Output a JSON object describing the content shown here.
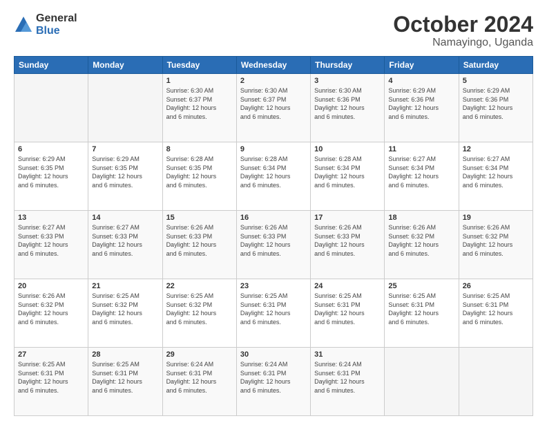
{
  "logo": {
    "general": "General",
    "blue": "Blue"
  },
  "header": {
    "month": "October 2024",
    "location": "Namayingo, Uganda"
  },
  "weekdays": [
    "Sunday",
    "Monday",
    "Tuesday",
    "Wednesday",
    "Thursday",
    "Friday",
    "Saturday"
  ],
  "weeks": [
    [
      {
        "day": "",
        "info": ""
      },
      {
        "day": "",
        "info": ""
      },
      {
        "day": "1",
        "info": "Sunrise: 6:30 AM\nSunset: 6:37 PM\nDaylight: 12 hours\nand 6 minutes."
      },
      {
        "day": "2",
        "info": "Sunrise: 6:30 AM\nSunset: 6:37 PM\nDaylight: 12 hours\nand 6 minutes."
      },
      {
        "day": "3",
        "info": "Sunrise: 6:30 AM\nSunset: 6:36 PM\nDaylight: 12 hours\nand 6 minutes."
      },
      {
        "day": "4",
        "info": "Sunrise: 6:29 AM\nSunset: 6:36 PM\nDaylight: 12 hours\nand 6 minutes."
      },
      {
        "day": "5",
        "info": "Sunrise: 6:29 AM\nSunset: 6:36 PM\nDaylight: 12 hours\nand 6 minutes."
      }
    ],
    [
      {
        "day": "6",
        "info": "Sunrise: 6:29 AM\nSunset: 6:35 PM\nDaylight: 12 hours\nand 6 minutes."
      },
      {
        "day": "7",
        "info": "Sunrise: 6:29 AM\nSunset: 6:35 PM\nDaylight: 12 hours\nand 6 minutes."
      },
      {
        "day": "8",
        "info": "Sunrise: 6:28 AM\nSunset: 6:35 PM\nDaylight: 12 hours\nand 6 minutes."
      },
      {
        "day": "9",
        "info": "Sunrise: 6:28 AM\nSunset: 6:34 PM\nDaylight: 12 hours\nand 6 minutes."
      },
      {
        "day": "10",
        "info": "Sunrise: 6:28 AM\nSunset: 6:34 PM\nDaylight: 12 hours\nand 6 minutes."
      },
      {
        "day": "11",
        "info": "Sunrise: 6:27 AM\nSunset: 6:34 PM\nDaylight: 12 hours\nand 6 minutes."
      },
      {
        "day": "12",
        "info": "Sunrise: 6:27 AM\nSunset: 6:34 PM\nDaylight: 12 hours\nand 6 minutes."
      }
    ],
    [
      {
        "day": "13",
        "info": "Sunrise: 6:27 AM\nSunset: 6:33 PM\nDaylight: 12 hours\nand 6 minutes."
      },
      {
        "day": "14",
        "info": "Sunrise: 6:27 AM\nSunset: 6:33 PM\nDaylight: 12 hours\nand 6 minutes."
      },
      {
        "day": "15",
        "info": "Sunrise: 6:26 AM\nSunset: 6:33 PM\nDaylight: 12 hours\nand 6 minutes."
      },
      {
        "day": "16",
        "info": "Sunrise: 6:26 AM\nSunset: 6:33 PM\nDaylight: 12 hours\nand 6 minutes."
      },
      {
        "day": "17",
        "info": "Sunrise: 6:26 AM\nSunset: 6:33 PM\nDaylight: 12 hours\nand 6 minutes."
      },
      {
        "day": "18",
        "info": "Sunrise: 6:26 AM\nSunset: 6:32 PM\nDaylight: 12 hours\nand 6 minutes."
      },
      {
        "day": "19",
        "info": "Sunrise: 6:26 AM\nSunset: 6:32 PM\nDaylight: 12 hours\nand 6 minutes."
      }
    ],
    [
      {
        "day": "20",
        "info": "Sunrise: 6:26 AM\nSunset: 6:32 PM\nDaylight: 12 hours\nand 6 minutes."
      },
      {
        "day": "21",
        "info": "Sunrise: 6:25 AM\nSunset: 6:32 PM\nDaylight: 12 hours\nand 6 minutes."
      },
      {
        "day": "22",
        "info": "Sunrise: 6:25 AM\nSunset: 6:32 PM\nDaylight: 12 hours\nand 6 minutes."
      },
      {
        "day": "23",
        "info": "Sunrise: 6:25 AM\nSunset: 6:31 PM\nDaylight: 12 hours\nand 6 minutes."
      },
      {
        "day": "24",
        "info": "Sunrise: 6:25 AM\nSunset: 6:31 PM\nDaylight: 12 hours\nand 6 minutes."
      },
      {
        "day": "25",
        "info": "Sunrise: 6:25 AM\nSunset: 6:31 PM\nDaylight: 12 hours\nand 6 minutes."
      },
      {
        "day": "26",
        "info": "Sunrise: 6:25 AM\nSunset: 6:31 PM\nDaylight: 12 hours\nand 6 minutes."
      }
    ],
    [
      {
        "day": "27",
        "info": "Sunrise: 6:25 AM\nSunset: 6:31 PM\nDaylight: 12 hours\nand 6 minutes."
      },
      {
        "day": "28",
        "info": "Sunrise: 6:25 AM\nSunset: 6:31 PM\nDaylight: 12 hours\nand 6 minutes."
      },
      {
        "day": "29",
        "info": "Sunrise: 6:24 AM\nSunset: 6:31 PM\nDaylight: 12 hours\nand 6 minutes."
      },
      {
        "day": "30",
        "info": "Sunrise: 6:24 AM\nSunset: 6:31 PM\nDaylight: 12 hours\nand 6 minutes."
      },
      {
        "day": "31",
        "info": "Sunrise: 6:24 AM\nSunset: 6:31 PM\nDaylight: 12 hours\nand 6 minutes."
      },
      {
        "day": "",
        "info": ""
      },
      {
        "day": "",
        "info": ""
      }
    ]
  ]
}
